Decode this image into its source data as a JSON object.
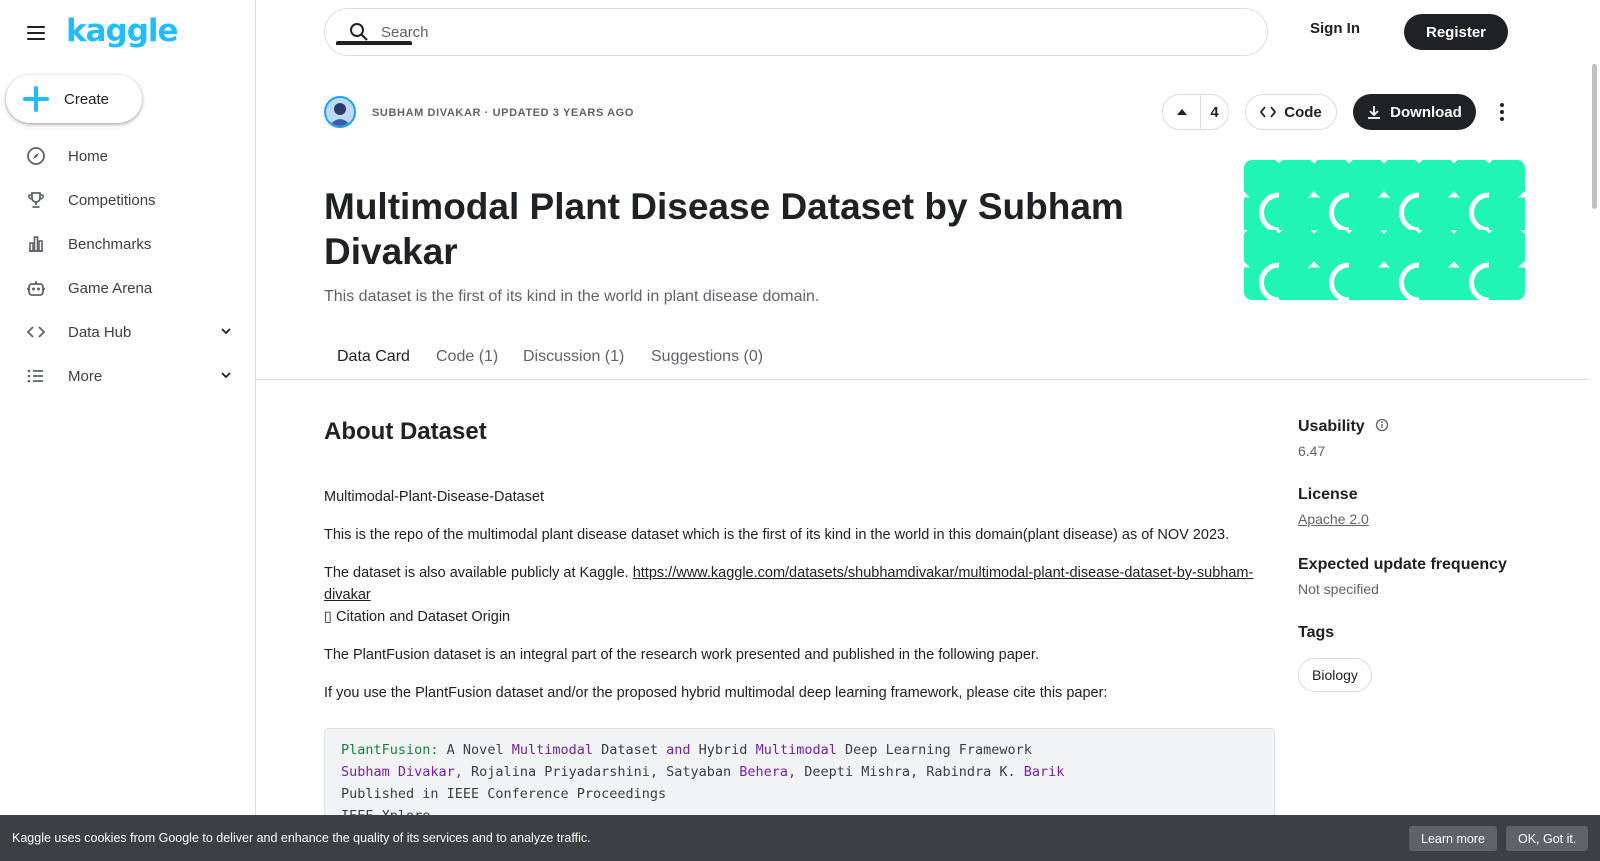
{
  "sidebar": {
    "logo": "kaggle",
    "create_label": "Create",
    "items": [
      {
        "label": "Home",
        "icon": "compass-icon"
      },
      {
        "label": "Competitions",
        "icon": "trophy-icon"
      },
      {
        "label": "Benchmarks",
        "icon": "bar-chart-icon"
      },
      {
        "label": "Game Arena",
        "icon": "robot-icon"
      },
      {
        "label": "Data Hub",
        "icon": "code-brackets-icon",
        "expandable": true
      },
      {
        "label": "More",
        "icon": "list-icon",
        "expandable": true
      }
    ]
  },
  "header": {
    "search_placeholder": "Search",
    "signin_label": "Sign In",
    "register_label": "Register"
  },
  "dataset": {
    "meta": "Subham Divakar · Updated 3 years ago",
    "vote_count": "4",
    "code_label": "Code",
    "download_label": "Download",
    "title": "Multimodal Plant Disease Dataset by Subham Divakar",
    "subtitle": "This dataset is the first of its kind in the world in plant disease domain.",
    "cover_color": "#20f5b5"
  },
  "tabs": [
    {
      "label": "Data Card",
      "active": true
    },
    {
      "label": "Code (1)"
    },
    {
      "label": "Discussion (1)"
    },
    {
      "label": "Suggestions (0)"
    }
  ],
  "about": {
    "heading": "About Dataset",
    "p1": "Multimodal-Plant-Disease-Dataset",
    "p2": "This is the repo of the multimodal plant disease dataset which is the first of its kind in the world in this domain(plant disease) as of NOV 2023.",
    "p3_text": "The dataset is also available publicly at Kaggle. ",
    "p3_link": "https://www.kaggle.com/datasets/shubhamdivakar/multimodal-plant-disease-dataset-by-subham-divakar",
    "p3_after": "▯ Citation and Dataset Origin",
    "p4": "The PlantFusion dataset is an integral part of the research work presented and published in the following paper.",
    "p5": "If you use the PlantFusion dataset and/or the proposed hybrid multimodal deep learning framework, please cite this paper:"
  },
  "codeblock": {
    "l1_a": "PlantFusion:",
    "l1_b": " A Novel ",
    "l1_c": "Multimodal",
    "l1_d": " Dataset ",
    "l1_e": "and",
    "l1_f": " Hybrid ",
    "l1_g": "Multimodal",
    "l1_h": " Deep Learning Framework",
    "l2_a": "Subham Divakar,",
    "l2_b": " Rojalina Priyadarshini, Satyaban ",
    "l2_c": "Behera,",
    "l2_d": " Deepti Mishra, Rabindra K. ",
    "l2_e": "Barik",
    "l3": "Published in IEEE Conference Proceedings",
    "l4": "IEEE Xplore"
  },
  "right_panel": {
    "usability_label": "Usability",
    "usability_value": "6.47",
    "license_label": "License",
    "license_value": "Apache 2.0",
    "frequency_label": "Expected update frequency",
    "frequency_value": "Not specified",
    "tags_label": "Tags",
    "tags": [
      "Biology"
    ]
  },
  "cookie": {
    "text": "Kaggle uses cookies from Google to deliver and enhance the quality of its services and to analyze traffic.",
    "learn_more": "Learn more",
    "ok": "OK, Got it."
  },
  "colors": {
    "accent": "#20beff",
    "dark": "#202124",
    "cover": "#20f5b5"
  }
}
